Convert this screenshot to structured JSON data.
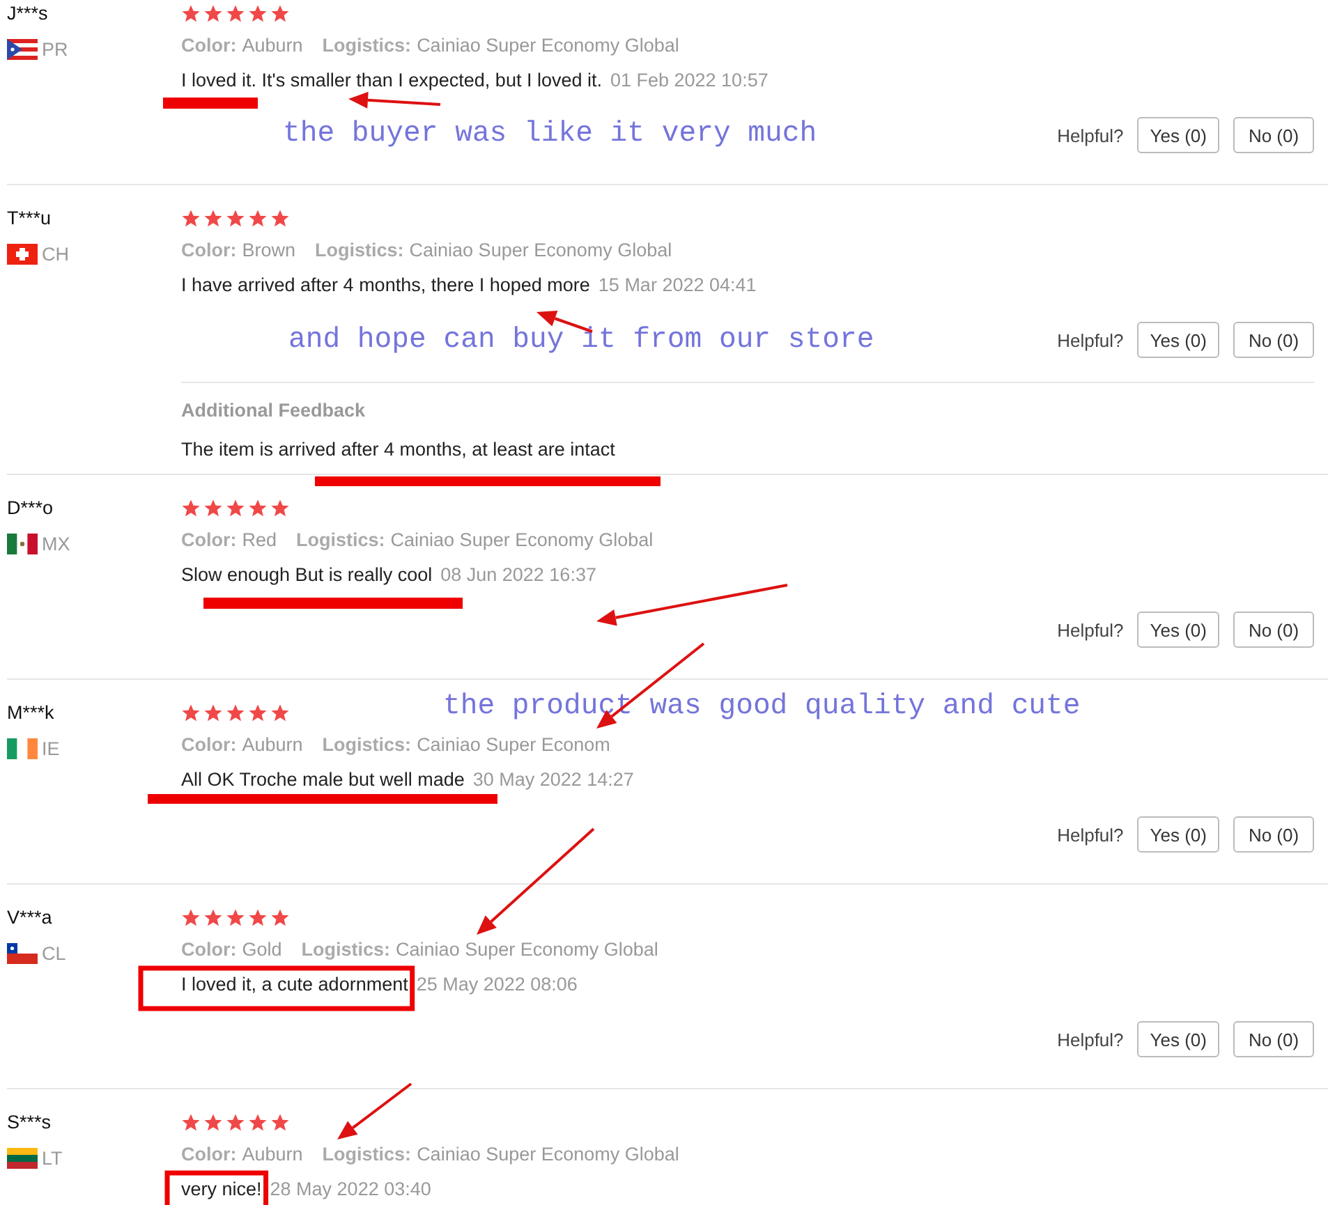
{
  "reviews": [
    {
      "name": "J***s",
      "country": "PR",
      "stars": 5,
      "color_label": "Color:",
      "color_value": "Auburn",
      "logistics_label": "Logistics:",
      "logistics": "Cainiao Super Economy Global",
      "comment": "I loved it. It's smaller than I expected, but I loved it.",
      "date": "01 Feb 2022 10:57",
      "helpful": {
        "label": "Helpful?",
        "yes": "Yes (0)",
        "no": "No (0)"
      }
    },
    {
      "name": "T***u",
      "country": "CH",
      "stars": 5,
      "color_label": "Color:",
      "color_value": "Brown",
      "logistics_label": "Logistics:",
      "logistics": "Cainiao Super Economy Global",
      "comment": "I have arrived after 4 months, there I hoped more",
      "date": "15 Mar 2022 04:41",
      "helpful": {
        "label": "Helpful?",
        "yes": "Yes (0)",
        "no": "No (0)"
      },
      "additional": {
        "title": "Additional Feedback",
        "text": "The item is arrived after 4 months, at least are intact"
      }
    },
    {
      "name": "D***o",
      "country": "MX",
      "stars": 5,
      "color_label": "Color:",
      "color_value": "Red",
      "logistics_label": "Logistics:",
      "logistics": "Cainiao Super Economy Global",
      "comment": "Slow enough But is really cool",
      "date": "08 Jun 2022 16:37",
      "helpful": {
        "label": "Helpful?",
        "yes": "Yes (0)",
        "no": "No (0)"
      }
    },
    {
      "name": "M***k",
      "country": "IE",
      "stars": 5,
      "color_label": "Color:",
      "color_value": "Auburn",
      "logistics_label": "Logistics:",
      "logistics": "Cainiao Super Econom",
      "comment": "All OK Troche male but well made",
      "date": "30 May 2022 14:27",
      "helpful": {
        "label": "Helpful?",
        "yes": "Yes (0)",
        "no": "No (0)"
      }
    },
    {
      "name": "V***a",
      "country": "CL",
      "stars": 5,
      "color_label": "Color:",
      "color_value": "Gold",
      "logistics_label": "Logistics:",
      "logistics": "Cainiao Super Economy Global",
      "comment": "I loved it, a cute adornment",
      "date": "25 May 2022 08:06",
      "helpful": {
        "label": "Helpful?",
        "yes": "Yes (0)",
        "no": "No (0)"
      }
    },
    {
      "name": "S***s",
      "country": "LT",
      "stars": 5,
      "color_label": "Color:",
      "color_value": "Auburn",
      "logistics_label": "Logistics:",
      "logistics": "Cainiao Super Economy Global",
      "comment": "very nice!",
      "date": "28 May 2022 03:40"
    }
  ],
  "annotation_captions": [
    "the buyer was like it very much",
    "and hope can buy it from our store",
    "the product was good quality and cute"
  ]
}
